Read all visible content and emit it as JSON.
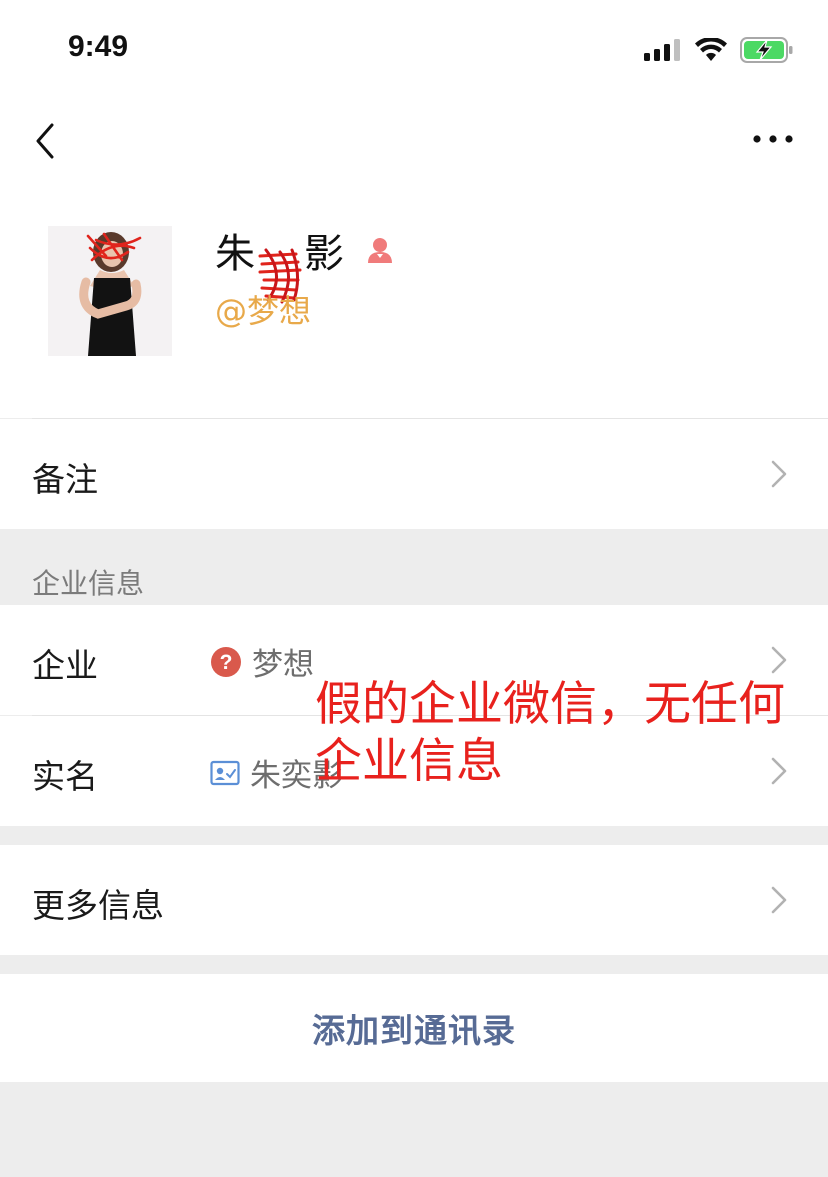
{
  "status_bar": {
    "time": "9:49"
  },
  "profile": {
    "name": "朱影",
    "name_first": "朱",
    "name_last": "影",
    "handle": "@梦想",
    "gender_icon": "female-user-icon"
  },
  "rows": {
    "remark_label": "备注",
    "section_title": "企业信息",
    "company_label": "企业",
    "company_value": "梦想",
    "company_icon": "question-icon",
    "realname_label": "实名",
    "realname_value": "朱奕影",
    "realname_icon": "id-card-icon",
    "more_label": "更多信息"
  },
  "annotation": "假的企业微信，无任何企业信息",
  "actions": {
    "add_contact": "添加到通讯录"
  },
  "colors": {
    "link": "#576b95",
    "handle": "#e8a94a",
    "annotation": "#e8211d",
    "question_badge": "#d9594c"
  }
}
